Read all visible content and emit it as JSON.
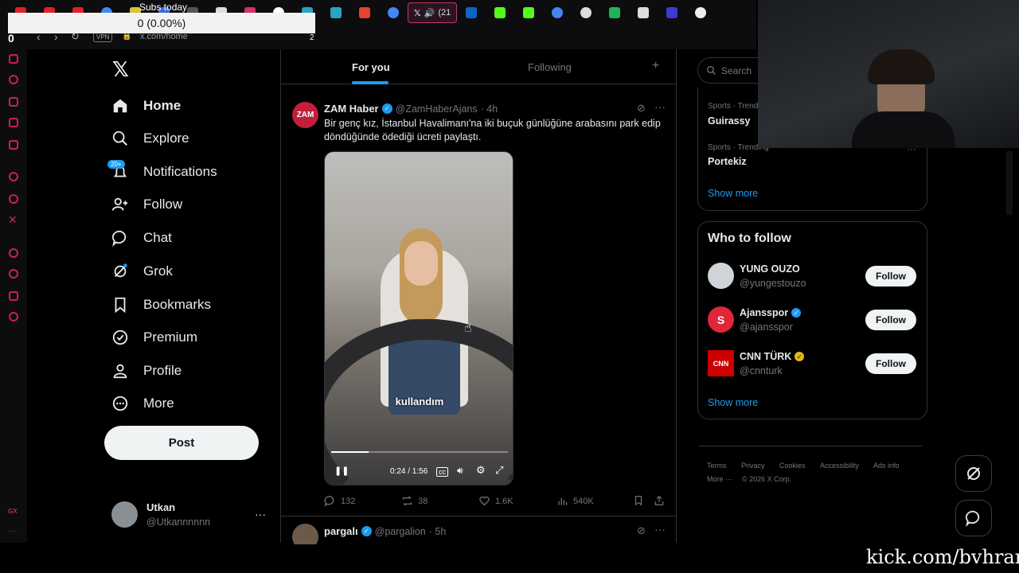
{
  "browser": {
    "url": "x.com/home",
    "vpn_label": "VPN",
    "tab_audio_label": "(21",
    "left_count": "0",
    "right_count": "2",
    "subs_today_label": "Subs today",
    "subs_value": "0 (0.00%)"
  },
  "nav": {
    "home": "Home",
    "explore": "Explore",
    "notifications": "Notifications",
    "notif_badge": "20+",
    "follow": "Follow",
    "chat": "Chat",
    "grok": "Grok",
    "bookmarks": "Bookmarks",
    "premium": "Premium",
    "profile": "Profile",
    "more": "More",
    "post": "Post"
  },
  "account": {
    "name": "Utkan",
    "handle": "@Utkannnnnn"
  },
  "feed_tabs": {
    "for_you": "For you",
    "following": "Following"
  },
  "tweet1": {
    "author": "ZAM Haber",
    "avatar_text": "ZAM",
    "handle": "@ZamHaberAjans",
    "time": "· 4h",
    "text": "Bir genç kız, İstanbul Havalimanı'na iki buçuk günlüğüne arabasını park edip döndüğünde ödediği ücreti paylaştı.",
    "caption": "kullandım",
    "video_time": "0:24 / 1:56",
    "video_progress": 0.21,
    "replies": "132",
    "reposts": "38",
    "likes": "1.6K",
    "views": "540K"
  },
  "tweet2": {
    "author": "pargalı",
    "handle": "@pargalion",
    "time": "· 5h"
  },
  "right": {
    "search_placeholder": "Search",
    "trends": [
      {
        "context": "Sports · Trend",
        "name": "Guirassy"
      },
      {
        "context": "Sports · Trending",
        "name": "Portekiz"
      }
    ],
    "show_more": "Show more",
    "wtf_title": "Who to follow",
    "wtf": [
      {
        "name": "YUNG OUZO",
        "handle": "@yungestouzo",
        "button": "Follow",
        "color": "#cfd4d8"
      },
      {
        "name": "Ajansspor",
        "handle": "@ajansspor",
        "button": "Follow",
        "color": "#e0263a"
      },
      {
        "name": "CNN TÜRK",
        "handle": "@cnnturk",
        "button": "Follow",
        "color": "#cc0000"
      }
    ],
    "show_more2": "Show more",
    "footer": [
      "Terms",
      "Privacy",
      "Cookies",
      "Accessibility",
      "Ads info",
      "More ···",
      "© 2026 X Corp."
    ]
  },
  "watermark": "kick.com/bvhran",
  "colors": {
    "accent": "#1d9bf0",
    "brand_pink": "#c8234e",
    "verified": "#1d9bf0",
    "gold_verified": "#e2b719"
  }
}
